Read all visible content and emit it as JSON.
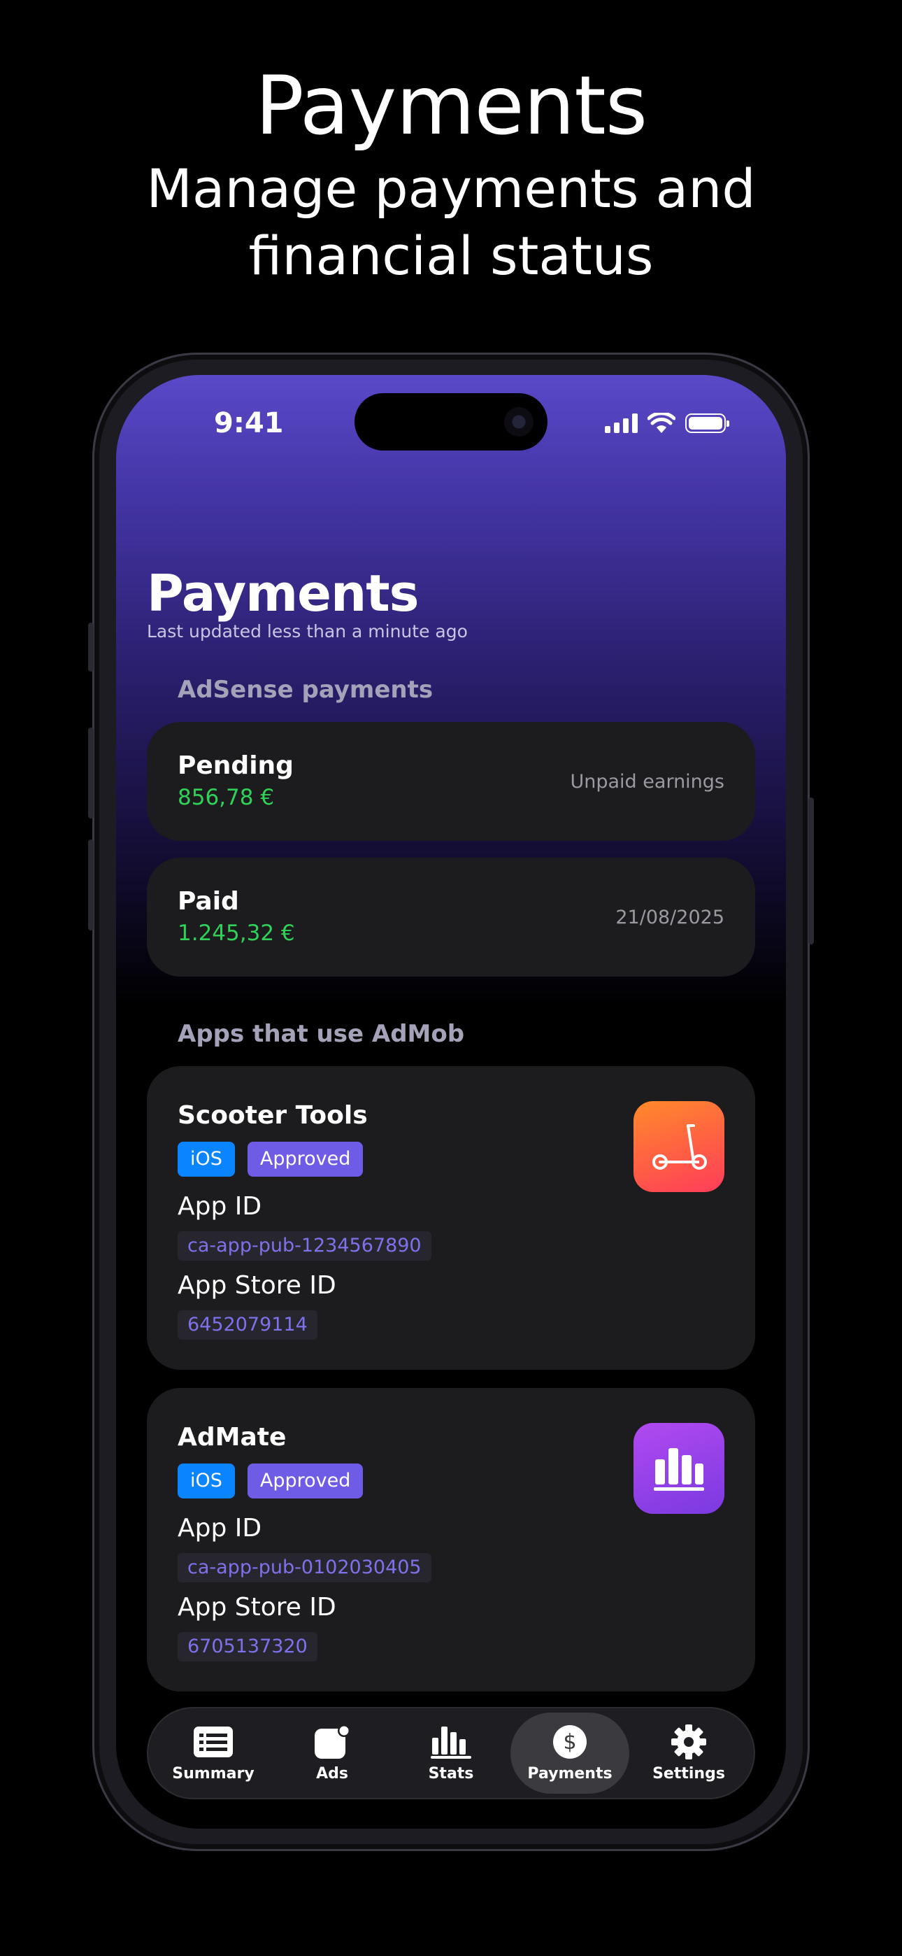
{
  "promo": {
    "title": "Payments",
    "subtitle": "Manage payments and financial status"
  },
  "status_bar": {
    "time": "9:41"
  },
  "header": {
    "title": "Payments",
    "updated": "Last updated less than a minute ago"
  },
  "adsense": {
    "section_title": "AdSense payments",
    "pending": {
      "label": "Pending",
      "amount": "856,78 €",
      "note": "Unpaid earnings"
    },
    "paid": {
      "label": "Paid",
      "amount": "1.245,32 €",
      "note": "21/08/2025"
    }
  },
  "admob": {
    "section_title": "Apps that use AdMob",
    "apps": [
      {
        "name": "Scooter Tools",
        "platform": "iOS",
        "status": "Approved",
        "app_id_label": "App ID",
        "app_id": "ca-app-pub-1234567890",
        "store_id_label": "App Store ID",
        "store_id": "6452079114",
        "icon": "scooter-icon"
      },
      {
        "name": "AdMate",
        "platform": "iOS",
        "status": "Approved",
        "app_id_label": "App ID",
        "app_id": "ca-app-pub-0102030405",
        "store_id_label": "App Store ID",
        "store_id": "6705137320",
        "icon": "bar-chart-icon"
      }
    ]
  },
  "tabbar": {
    "tabs": [
      {
        "label": "Summary",
        "icon": "list-icon"
      },
      {
        "label": "Ads",
        "icon": "ads-icon"
      },
      {
        "label": "Stats",
        "icon": "stats-icon"
      },
      {
        "label": "Payments",
        "icon": "dollar-icon",
        "active": true
      },
      {
        "label": "Settings",
        "icon": "gear-icon"
      }
    ]
  },
  "colors": {
    "accent": "#6e5ce6",
    "ios_badge": "#0a84ff",
    "money": "#30d158"
  }
}
